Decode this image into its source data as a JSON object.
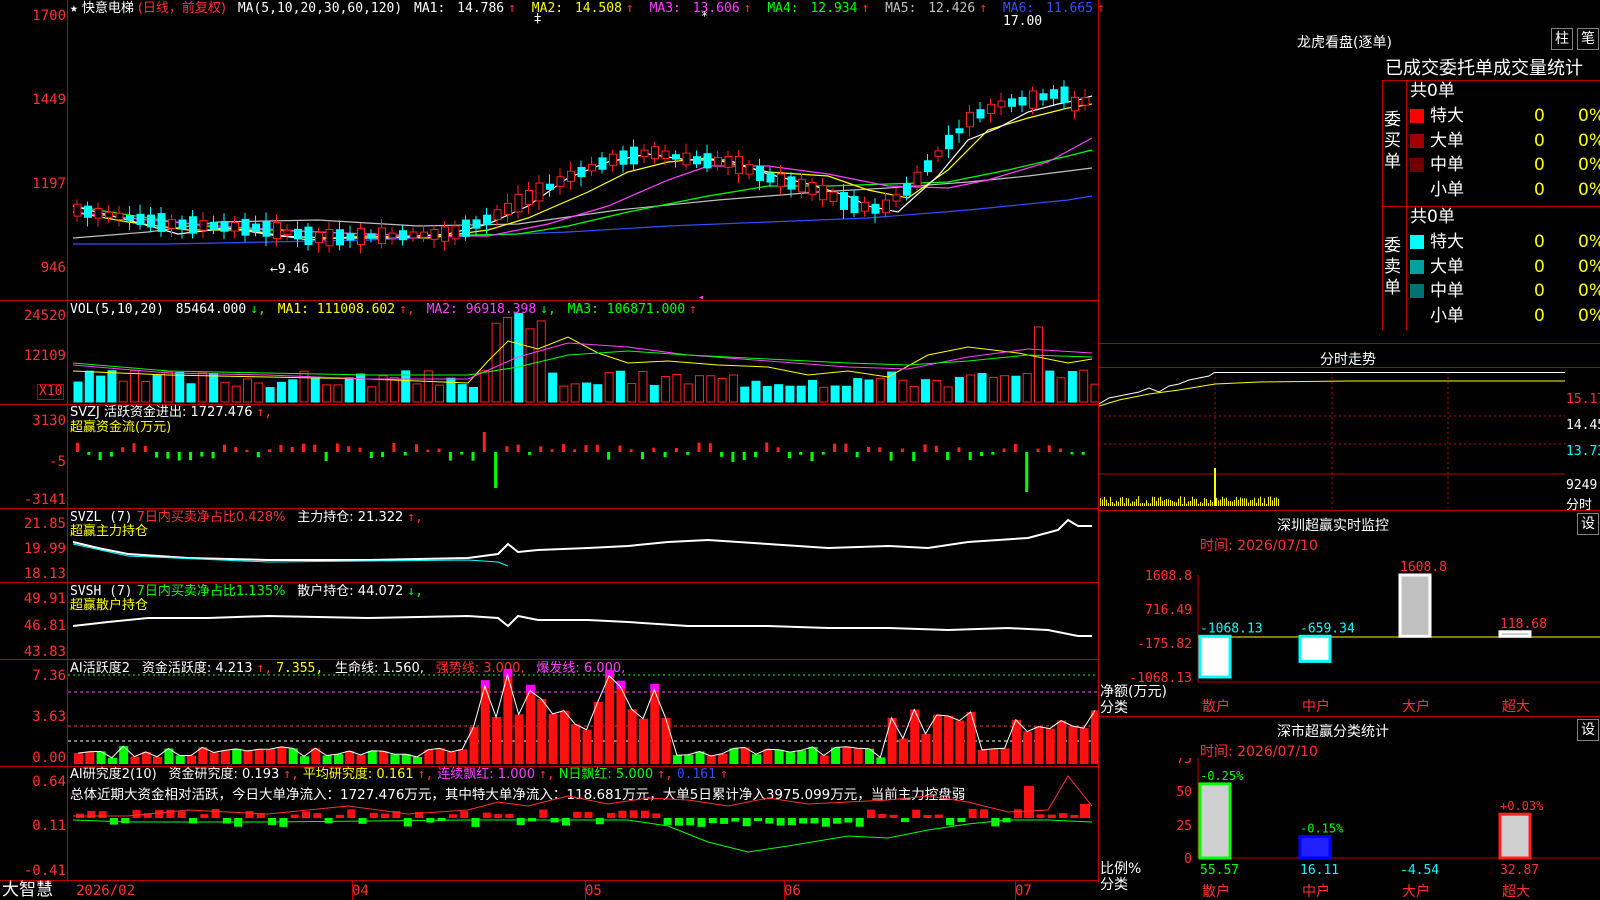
{
  "main": {
    "title_star": "★",
    "stock_name": "快意电梯",
    "period": "(日线，前复权)",
    "ma_def": "MA(5,10,20,30,60,120)",
    "ma": [
      {
        "label": "MA1:",
        "value": "14.786",
        "arrow": "↑",
        "color": "#ffffff"
      },
      {
        "label": "MA2:",
        "value": "14.508",
        "arrow": "↑",
        "color": "#ffff00"
      },
      {
        "label": "MA3:",
        "value": "13.606",
        "arrow": "↑",
        "color": "#ff40ff"
      },
      {
        "label": "MA4:",
        "value": "12.934",
        "arrow": "↑",
        "color": "#00ff00"
      },
      {
        "label": "MA5:",
        "value": "12.426",
        "arrow": "↑",
        "color": "#c0c0c0"
      },
      {
        "label": "MA6:",
        "value": "11.665",
        "arrow": "↑",
        "color": "#3050ff"
      }
    ],
    "y_ticks": [
      "1700",
      "1449",
      "1197",
      "946"
    ],
    "high_label": "17.00",
    "low_label": "←9.46"
  },
  "vol": {
    "header_def": "VOL(5,10,20)",
    "value": "85464.000",
    "value_arrow": "↓,",
    "ma1": "MA1: 111008.602",
    "ma1_arrow": "↑,",
    "ma2": "MA2: 96918.398",
    "ma2_arrow": "↓,",
    "ma3": "MA3: 106871.000",
    "ma3_arrow": "↑",
    "y_ticks": [
      "24520",
      "12109"
    ],
    "unit": "X10"
  },
  "svzj": {
    "line1": "SVZJ  活跃资金进出: 1727.476",
    "line1_arrow": "↑,",
    "line2": "超赢资金流(万元)",
    "y_ticks": [
      "3130",
      "-5",
      "-3141"
    ]
  },
  "svzl": {
    "name": "SVZL (7)",
    "desc": "7日内买卖净占比0.428%",
    "hold": "主力持仓: 21.322",
    "hold_arrow": "↑,",
    "line2": "超赢主力持仓",
    "y_ticks": [
      "21.85",
      "19.99",
      "18.13"
    ]
  },
  "svsh": {
    "name": "SVSH (7)",
    "desc": "7日内买卖净占比1.135%",
    "hold": "散户持仓: 44.072",
    "hold_arrow": "↓,",
    "line2": "超赢散户持仓",
    "y_ticks": [
      "49.91",
      "46.81",
      "43.83"
    ]
  },
  "ai1": {
    "name": "AI活跃度2",
    "activity": "资金活跃度: 4.213",
    "a1": "↑,",
    "v2": "7.355,",
    "life": "生命线: 1.560,",
    "strong": "强势线: 3.000,",
    "burst": "爆发线: 6.000,",
    "y_ticks": [
      "7.36",
      "3.63",
      "0.00"
    ]
  },
  "ai2": {
    "name": "AI研究度2(10)",
    "research": "资金研究度: 0.193",
    "r_arrow": "↑,",
    "avg": "平均研究度: 0.161",
    "avg_arrow": "↑,",
    "cont": "连续飘红: 1.000",
    "cont_arrow": "↑,",
    "nday": "N日飘红: 5.000",
    "nday_arrow": "↑,",
    "last": "0.161",
    "last_arrow": "↑",
    "summary": "总体近期大资金相对活跃，今日大单净流入：1727.476万元，其中特大单净流入：118.681万元，大单5日累计净入3975.099万元，当前主力控盘弱",
    "y_ticks": [
      "0.64",
      "0.11",
      "-0.41"
    ]
  },
  "bottom": {
    "brand": "大智慧",
    "dates": [
      "2026/02",
      "04",
      "05",
      "06",
      "07"
    ]
  },
  "right": {
    "dragon_title": "龙虎看盘(逐单)",
    "btn_zhu": "柱",
    "btn_bi": "笔",
    "stat_title": "已成交委托单成交量统计",
    "buy_side_label": "委买单",
    "sell_side_label": "委卖单",
    "buy_total": "共0单",
    "sell_total": "共0单",
    "buy_rows": [
      {
        "name": "特大",
        "count": "0",
        "pct": "0%",
        "color": "#ff0000"
      },
      {
        "name": "大单",
        "count": "0",
        "pct": "0%",
        "color": "#a00000"
      },
      {
        "name": "中单",
        "count": "0",
        "pct": "0%",
        "color": "#700000"
      },
      {
        "name": "小单",
        "count": "0",
        "pct": "0%",
        "color": ""
      }
    ],
    "sell_rows": [
      {
        "name": "特大",
        "count": "0",
        "pct": "0%",
        "color": "#00ffff"
      },
      {
        "name": "大单",
        "count": "0",
        "pct": "0%",
        "color": "#00a0a0"
      },
      {
        "name": "中单",
        "count": "0",
        "pct": "0%",
        "color": "#007070"
      },
      {
        "name": "小单",
        "count": "0",
        "pct": "0%",
        "color": ""
      }
    ],
    "intraday_title": "分时走势",
    "intraday_ticks": [
      "15.17",
      "14.45",
      "13.73"
    ],
    "intraday_vol": "9249",
    "intraday_unit": "分时",
    "sz_title": "深圳超赢实时监控",
    "sz_btn": "设",
    "sz_time": "时间: 2026/07/10",
    "sz_axis_label": "净额(万元)",
    "sz_axis_label2": "分类",
    "sz_yticks": [
      "1608.8",
      "716.49",
      "-175.82",
      "-1068.13"
    ],
    "sz_values": [
      {
        "cat": "散户",
        "value": "-1068.13"
      },
      {
        "cat": "中户",
        "value": "-659.34"
      },
      {
        "cat": "大户",
        "value": "1608.8"
      },
      {
        "cat": "超大",
        "value": "118.68"
      }
    ],
    "cls_title": "深市超赢分类统计",
    "cls_btn": "设",
    "cls_time": "时间: 2026/07/10",
    "cls_axis_label": "比例%",
    "cls_axis_label2": "分类",
    "cls_yticks": [
      "75",
      "50",
      "25",
      "0"
    ],
    "cls_values": [
      {
        "cat": "散户",
        "pct": "55.57",
        "change": "-0.25%"
      },
      {
        "cat": "中户",
        "pct": "16.11",
        "change": "-0.15%"
      },
      {
        "cat": "大户",
        "pct": "-4.54",
        "change": ""
      },
      {
        "cat": "超大",
        "pct": "32.87",
        "change": "+0.03%"
      }
    ]
  }
}
